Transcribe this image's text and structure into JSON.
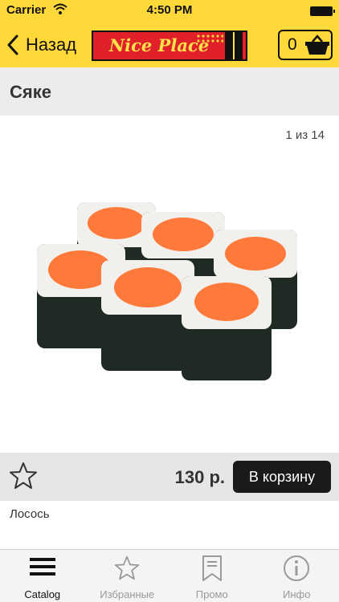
{
  "status_bar": {
    "carrier": "Carrier",
    "time": "4:50 PM"
  },
  "header": {
    "back_label": "Назад",
    "logo_text": "Nice Place",
    "cart_count": "0"
  },
  "product": {
    "title": "Сяке",
    "image_counter": "1 из 14",
    "price": "130 р.",
    "buy_label": "В корзину",
    "description": "Лосось",
    "image_icon": "sushi-rolls-image"
  },
  "colors": {
    "accent_yellow": "#ffd83a",
    "logo_red": "#e0212a",
    "button_dark": "#1a1a1a"
  },
  "tabbar": {
    "tabs": [
      {
        "label": "Catalog",
        "icon": "menu-lines-icon",
        "active": true
      },
      {
        "label": "Избранные",
        "icon": "star-icon",
        "active": false
      },
      {
        "label": "Промо",
        "icon": "bookmark-icon",
        "active": false
      },
      {
        "label": "Инфо",
        "icon": "info-icon",
        "active": false
      }
    ]
  }
}
